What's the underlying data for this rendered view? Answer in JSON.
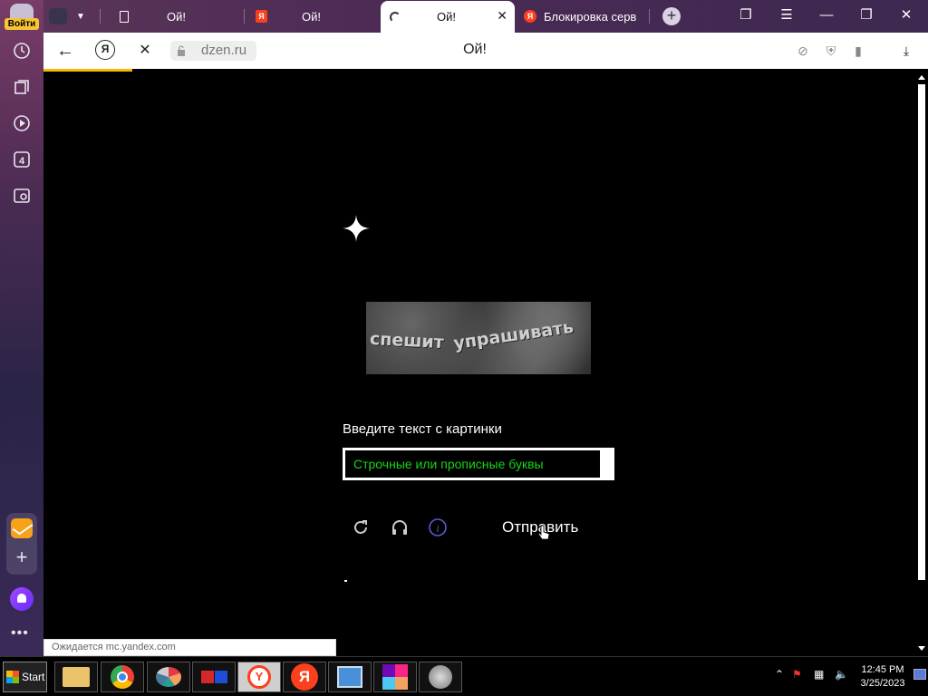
{
  "sidebar": {
    "login_label": "Войти",
    "tab_count": "4",
    "items": [
      "history-icon",
      "collections-icon",
      "video-icon",
      "tabs-count-icon",
      "screenshot-icon"
    ]
  },
  "tabs": [
    {
      "label": "Ой!",
      "icon": "document-icon"
    },
    {
      "label": "Ой!",
      "icon": "yandex-document-icon"
    },
    {
      "label": "Ой!",
      "icon": "loading-spinner-icon",
      "active": true
    },
    {
      "label": "Блокировка серв",
      "icon": "yandex-icon"
    }
  ],
  "navbar": {
    "url": "dzen.ru",
    "page_title": "Ой!"
  },
  "captcha": {
    "image_text_1": "спешит",
    "image_text_2": "упрашивать",
    "prompt": "Введите текст с картинки",
    "input_placeholder": "Строчные или прописные буквы",
    "submit_label": "Отправить"
  },
  "status_bar": {
    "text": "Ожидается mc.yandex.com"
  },
  "taskbar": {
    "start_label": "Start",
    "time": "12:45 PM",
    "date": "3/25/2023",
    "apps": [
      "file-manager-icon",
      "chrome-icon",
      "paint-icon",
      "game-icon",
      "yandex-browser-icon",
      "yandex-icon",
      "control-panel-icon",
      "colors-app-icon",
      "speaker-app-icon"
    ]
  },
  "colors": {
    "accent": "#f6b800",
    "input_text": "#19d619",
    "yandex_red": "#fc3f1d"
  }
}
